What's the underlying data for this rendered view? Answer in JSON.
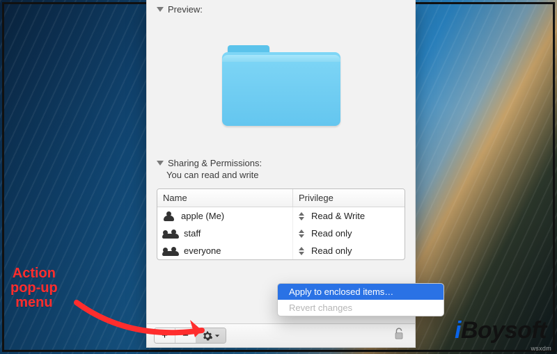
{
  "preview": {
    "label": "Preview:"
  },
  "sharing": {
    "label": "Sharing & Permissions:",
    "summary": "You can read and write",
    "columns": {
      "name": "Name",
      "priv": "Privilege"
    },
    "rows": [
      {
        "icon": "person",
        "name": "apple (Me)",
        "priv": "Read & Write"
      },
      {
        "icon": "group",
        "name": "staff",
        "priv": "Read only"
      },
      {
        "icon": "group",
        "name": "everyone",
        "priv": "Read only"
      }
    ]
  },
  "footer": {
    "add": "+",
    "remove": "−"
  },
  "menu": {
    "apply": "Apply to enclosed items…",
    "revert": "Revert changes"
  },
  "annotation": {
    "line1": "Action",
    "line2": "pop-up",
    "line3": "menu"
  },
  "watermark": {
    "i": "i",
    "rest": "Boysoft"
  },
  "corner_text": "wsxdm"
}
